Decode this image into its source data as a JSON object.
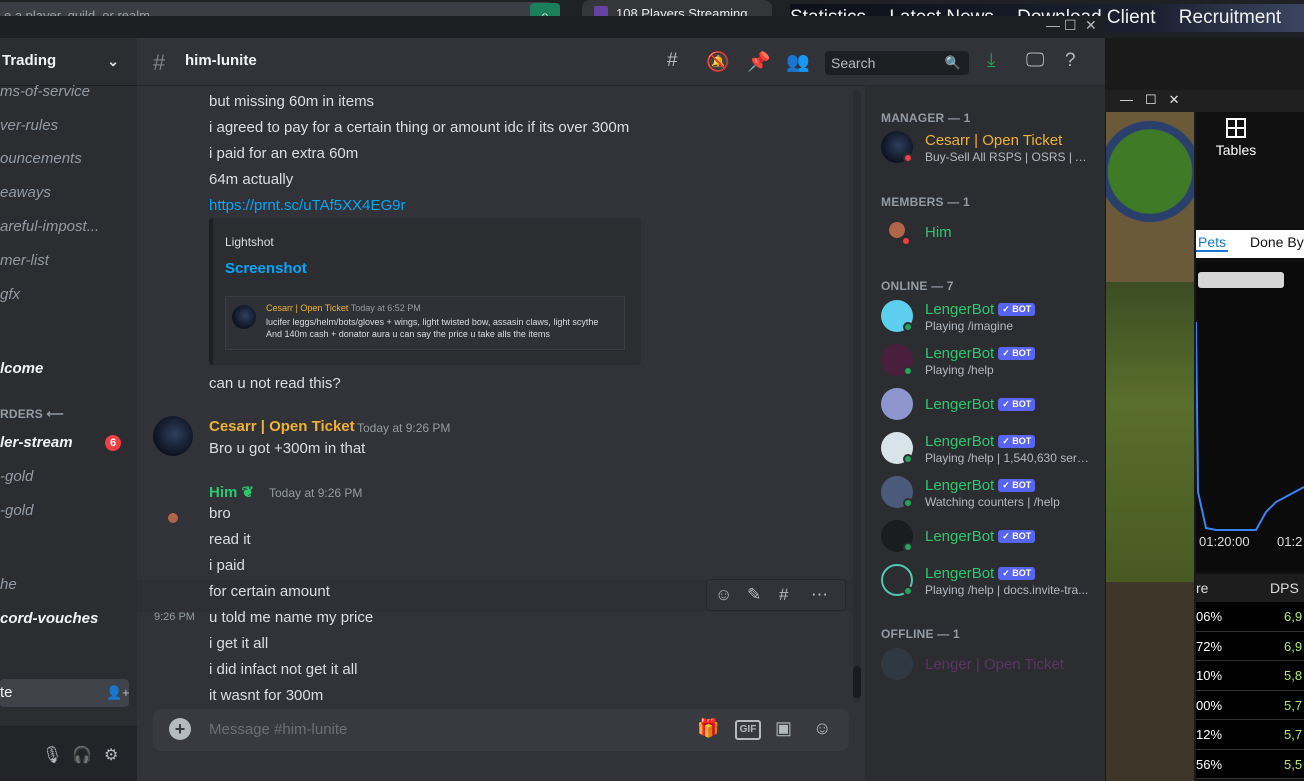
{
  "background": {
    "search_text": "e a player, guild, or realm",
    "tab_title": "108 Players Streaming",
    "nav_items": [
      "Statistics",
      "Latest News",
      "Download Client",
      "Recruitment"
    ],
    "tables_label": "Tables",
    "tabs": [
      "Pets",
      "Done By"
    ],
    "times": [
      "01:20:00",
      "01:2"
    ],
    "table_head": [
      "re",
      "DPS"
    ],
    "table_rows": [
      {
        "l": "06%",
        "r": "6,9"
      },
      {
        "l": "72%",
        "r": "6,9"
      },
      {
        "l": "10%",
        "r": "5,8"
      },
      {
        "l": "00%",
        "r": "5,7"
      },
      {
        "l": "12%",
        "r": "5,7"
      },
      {
        "l": "56%",
        "r": "5,5"
      }
    ]
  },
  "server": {
    "name": "Trading"
  },
  "channels": [
    {
      "label": "ms-of-service"
    },
    {
      "label": "ver-rules"
    },
    {
      "label": "ouncements"
    },
    {
      "label": "eaways"
    },
    {
      "label": "areful-impost..."
    },
    {
      "label": "mer-list"
    },
    {
      "label": "gfx"
    },
    {
      "label": "lcome"
    },
    {
      "label": "RDERS ⟵"
    },
    {
      "label": "ler-stream",
      "badge": "6"
    },
    {
      "label": "-gold"
    },
    {
      "label": "-gold"
    },
    {
      "label": "he"
    },
    {
      "label": "cord-vouches"
    },
    {
      "label": "te"
    }
  ],
  "header": {
    "channel_name": "him-lunite",
    "search_placeholder": "Search"
  },
  "messages": {
    "pre_lines": [
      "but missing 60m in items",
      "i agreed to pay for a certain thing or amount idc if its over 300m",
      "i paid for an extra 60m",
      "64m actually"
    ],
    "link": "https://prnt.sc/uTAf5XX4EG9r",
    "embed": {
      "provider": "Lightshot",
      "title": "Screenshot",
      "inner_name": "Cesarr | Open Ticket",
      "inner_time": "Today at 6:52 PM",
      "inner_line1": "lucifer leggs/helm/bots/gloves + wings, light twisted bow, assasin claws, light scythe",
      "inner_line2": "And 140m cash + donator aura u can say the price u take alls the items"
    },
    "after_embed": "can u not read this?",
    "msg1": {
      "author": "Cesarr | Open Ticket",
      "time": "Today at 9:26 PM",
      "text": "Bro u got +300m in that"
    },
    "msg2": {
      "author": "Him",
      "time": "Today at 9:26 PM",
      "lines": [
        "bro",
        "read it",
        "i paid",
        "for certain amount",
        "u told me name my price",
        "i get it all",
        "i did infact not get it all",
        "it wasnt for 300m"
      ],
      "hover_time": "9:26 PM"
    }
  },
  "composer": {
    "placeholder": "Message #him-lunite",
    "gif_label": "GIF"
  },
  "members": {
    "sections": {
      "manager": "MANAGER — 1",
      "members": "MEMBERS — 1",
      "online": "ONLINE — 7",
      "offline": "OFFLINE — 1"
    },
    "manager": {
      "name": "Cesarr | Open Ticket",
      "sub": "Buy-Sell All RSPS | OSRS | AL..."
    },
    "member": {
      "name": "Him"
    },
    "online": [
      {
        "name": "LengerBot",
        "sub": "Playing /imagine"
      },
      {
        "name": "LengerBot",
        "sub": "Playing /help"
      },
      {
        "name": "LengerBot",
        "sub": ""
      },
      {
        "name": "LengerBot",
        "sub": "Playing /help | 1,540,630 serv..."
      },
      {
        "name": "LengerBot",
        "sub": "Watching counters | /help"
      },
      {
        "name": "LengerBot",
        "sub": ""
      },
      {
        "name": "LengerBot",
        "sub": "Playing /help | docs.invite-tra..."
      }
    ],
    "bot_tag": "✓ BOT",
    "offline": {
      "name": "Lenger | Open Ticket"
    }
  },
  "colors": {
    "manager_role": "#f0b232",
    "green_role": "#2dc770",
    "offline_role": "#7b4a8a",
    "link": "#00a8fc"
  }
}
